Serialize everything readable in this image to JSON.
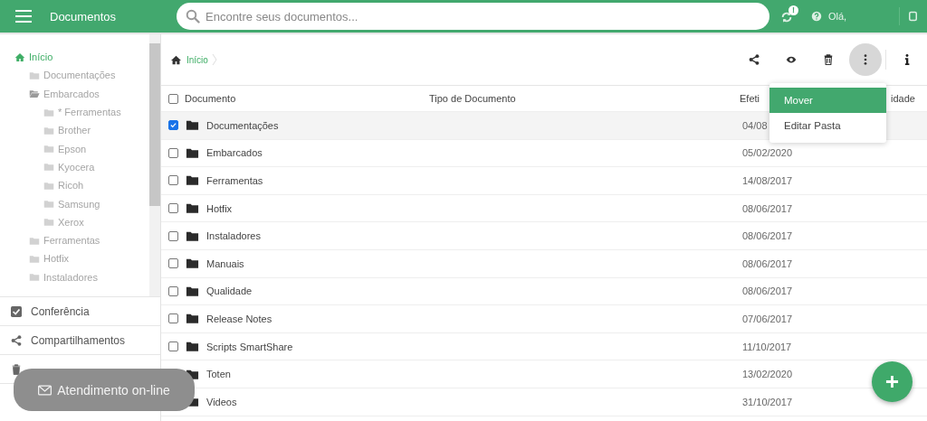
{
  "header": {
    "title": "Documentos",
    "search": {
      "placeholder": "Encontre seus documentos..."
    },
    "sync_badge": "!",
    "greeting": "Olá,"
  },
  "sidebar": {
    "tree": [
      {
        "label": "Início",
        "selected": true,
        "children": [
          {
            "label": "Documentações",
            "selected": false,
            "expanded": false
          },
          {
            "label": "Embarcados",
            "selected": false,
            "expanded": true,
            "children": [
              {
                "label": "* Ferramentas",
                "selected": false,
                "expanded": false
              },
              {
                "label": "Brother",
                "selected": false,
                "expanded": false
              },
              {
                "label": "Epson",
                "selected": false,
                "expanded": false
              },
              {
                "label": "Kyocera",
                "selected": false,
                "expanded": false
              },
              {
                "label": "Ricoh",
                "selected": false,
                "expanded": false
              },
              {
                "label": "Samsung",
                "selected": false,
                "expanded": false
              },
              {
                "label": "Xerox",
                "selected": false,
                "expanded": false
              }
            ]
          },
          {
            "label": "Ferramentas",
            "selected": false,
            "expanded": false
          },
          {
            "label": "Hotfix",
            "selected": false,
            "expanded": false
          },
          {
            "label": "Instaladores",
            "selected": false,
            "expanded": false
          }
        ]
      }
    ],
    "menu": [
      {
        "kind": "check",
        "label": "Conferência"
      },
      {
        "kind": "share",
        "label": "Compartilhamentos"
      },
      {
        "kind": "trash"
      }
    ]
  },
  "breadcrumb": [
    "Início"
  ],
  "toolbar": {
    "actions": [
      {
        "kind": "share",
        "active": false
      },
      {
        "kind": "eye",
        "active": false
      },
      {
        "kind": "trash",
        "active": false
      },
      {
        "kind": "more",
        "active": true
      },
      {
        "kind": "info",
        "active": false
      }
    ]
  },
  "table": {
    "columns": [
      "Documento",
      "Tipo de Documento",
      "Efeti",
      "idade"
    ],
    "all_checked": false,
    "rows": [
      {
        "name": "Documentações",
        "date": "04/08",
        "selected": true
      },
      {
        "name": "Embarcados",
        "date": "05/02/2020",
        "selected": false
      },
      {
        "name": "Ferramentas",
        "date": "14/08/2017",
        "selected": false
      },
      {
        "name": "Hotfix",
        "date": "08/06/2017",
        "selected": false
      },
      {
        "name": "Instaladores",
        "date": "08/06/2017",
        "selected": false
      },
      {
        "name": "Manuais",
        "date": "08/06/2017",
        "selected": false
      },
      {
        "name": "Qualidade",
        "date": "08/06/2017",
        "selected": false
      },
      {
        "name": "Release Notes",
        "date": "07/06/2017",
        "selected": false
      },
      {
        "name": "Scripts SmartShare",
        "date": "11/10/2017",
        "selected": false
      },
      {
        "name": "Toten",
        "date": "13/02/2020"
      },
      {
        "name": "Videos",
        "date": "31/10/2017"
      }
    ]
  },
  "context_menu": [
    {
      "label": "Mover",
      "selected": true
    },
    {
      "label": "Editar Pasta",
      "selected": false
    }
  ],
  "chat_button": "Atendimento on-line"
}
